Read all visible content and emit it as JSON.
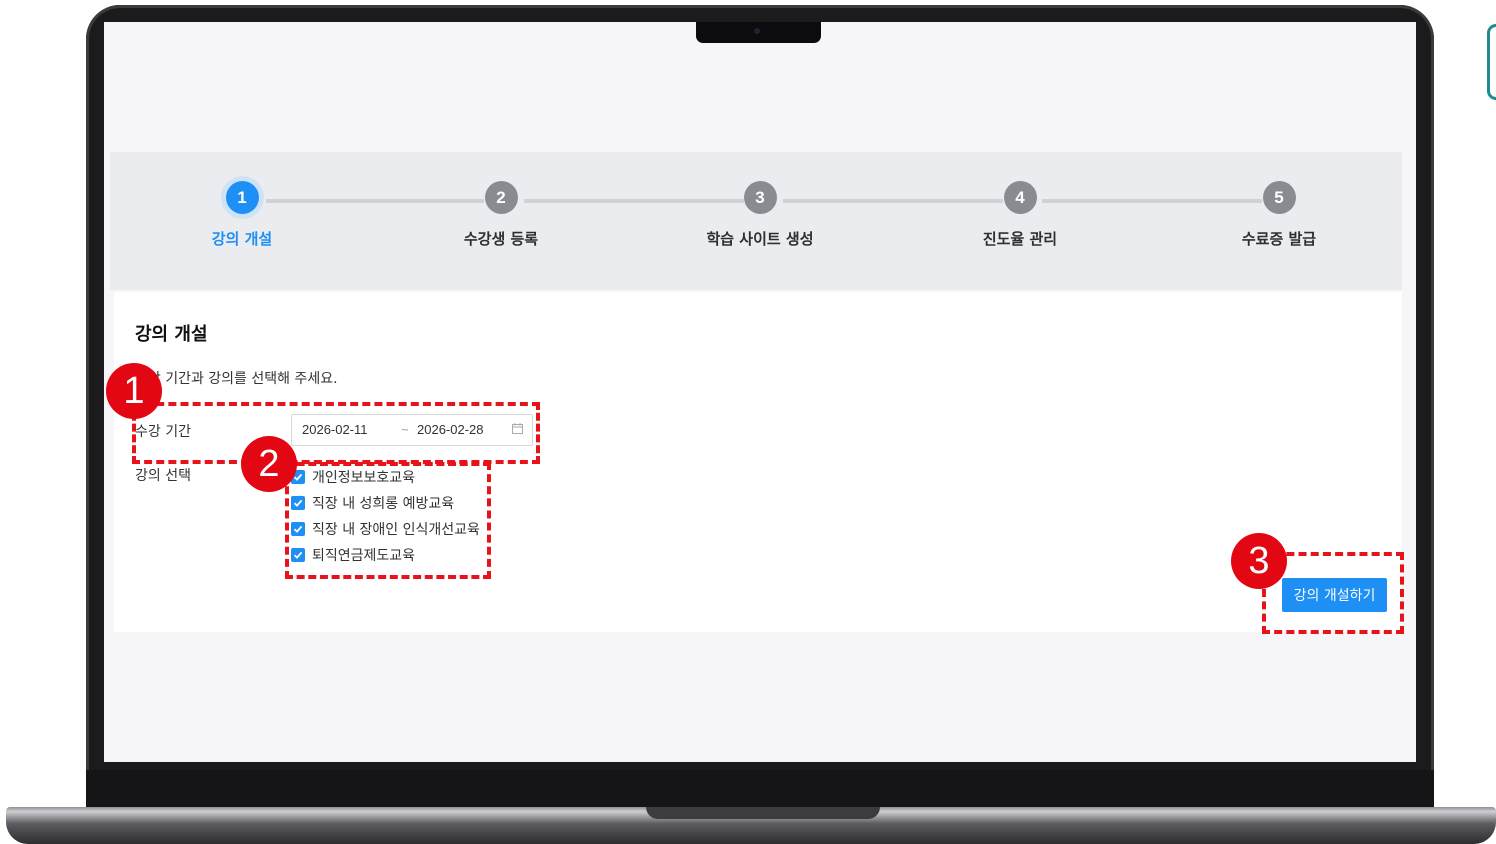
{
  "stepper": {
    "steps": [
      {
        "number": "1",
        "label": "강의 개설",
        "active": true
      },
      {
        "number": "2",
        "label": "수강생 등록",
        "active": false
      },
      {
        "number": "3",
        "label": "학습 사이트 생성",
        "active": false
      },
      {
        "number": "4",
        "label": "진도율 관리",
        "active": false
      },
      {
        "number": "5",
        "label": "수료증 발급",
        "active": false
      }
    ]
  },
  "form": {
    "title": "강의 개설",
    "description": "수강 기간과 강의를 선택해 주세요.",
    "period_label": "수강 기간",
    "start_date": "2026-02-11",
    "separator": "~",
    "end_date": "2026-02-28",
    "course_label": "강의 선택",
    "courses": [
      {
        "label": "개인정보보호교육",
        "checked": true
      },
      {
        "label": "직장 내 성희롱 예방교육",
        "checked": true
      },
      {
        "label": "직장 내 장애인 인식개선교육",
        "checked": true
      },
      {
        "label": "퇴직연금제도교육",
        "checked": true
      }
    ],
    "submit_label": "강의 개설하기"
  },
  "annotations": {
    "badges": [
      "1",
      "2",
      "3"
    ]
  },
  "colors": {
    "accent": "#1e8ff5",
    "annotation_red": "#e30613",
    "step_inactive": "#8a8b90"
  }
}
